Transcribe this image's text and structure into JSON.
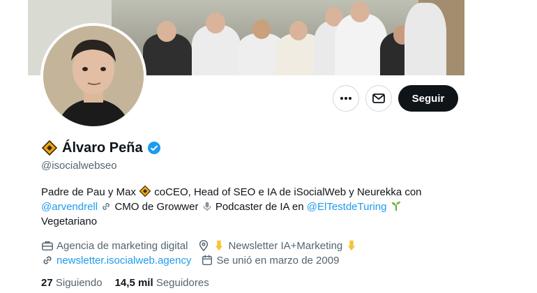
{
  "profile": {
    "name": "Álvaro Peña",
    "handle": "@isocialwebseo",
    "follow_label": "Seguir"
  },
  "bio": {
    "line1_text": "Padre de Pau y Max",
    "line1_rest": "coCEO, Head of SEO e IA de iSocialWeb y Neurekka con",
    "mention1": "@arvendrell",
    "cmo_text": "CMO de Growwer",
    "podcast_text": "Podcaster de IA en",
    "mention2": "@ElTestdeTuring",
    "line3": "Vegetariano"
  },
  "meta": {
    "category": "Agencia de marketing digital",
    "location": "Newsletter IA+Marketing",
    "website": "newsletter.isocialweb.agency",
    "joined": "Se unió en marzo de 2009"
  },
  "counts": {
    "following_value": "27",
    "following_label": "Siguiendo",
    "followers_value": "14,5 mil",
    "followers_label": "Seguidores"
  },
  "icons": {
    "more": "more-icon",
    "message": "mail-icon",
    "verified": "verified-badge-icon",
    "category": "briefcase-icon",
    "location": "location-pin-icon",
    "website": "link-icon",
    "joined": "calendar-icon"
  },
  "colors": {
    "accent": "#1d9bf0",
    "text": "#0f1419",
    "secondary": "#536471",
    "follow_bg": "#0f1419"
  }
}
